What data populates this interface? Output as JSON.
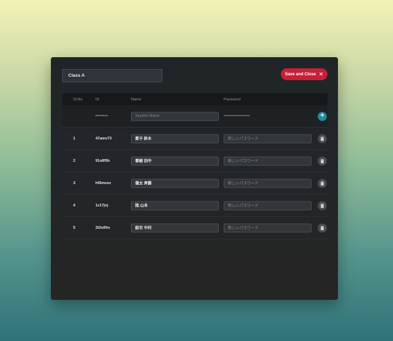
{
  "class_name": "Class A",
  "save_button_label": "Save and Close",
  "columns": {
    "no": "Sl.No",
    "id": "ID",
    "name": "Name",
    "password": "Password"
  },
  "new_row": {
    "id_mask": "•••••••",
    "name_placeholder": "Student Name",
    "password_mask": "•••••••••••••••••"
  },
  "rows": [
    {
      "no": "1",
      "id": "47amv73",
      "name": "愛子 鈴木",
      "password_placeholder": "新しいパスワード"
    },
    {
      "no": "2",
      "id": "91s8f5h",
      "name": "春樹 田中",
      "password_placeholder": "新しいパスワード"
    },
    {
      "no": "3",
      "id": "hf6mxsx",
      "name": "健太 斉藤",
      "password_placeholder": "新しいパスワード"
    },
    {
      "no": "4",
      "id": "1z17jvj",
      "name": "陸 山本",
      "password_placeholder": "新しいパスワード"
    },
    {
      "no": "5",
      "id": "2t2u0hv",
      "name": "結衣 中村",
      "password_placeholder": "新しいパスワード"
    }
  ],
  "colors": {
    "accent": "#c81f38",
    "add": "#1f8d96",
    "panel": "#22252a"
  },
  "icons": {
    "close": "close-icon",
    "add": "plus-icon",
    "delete": "trash-icon"
  }
}
